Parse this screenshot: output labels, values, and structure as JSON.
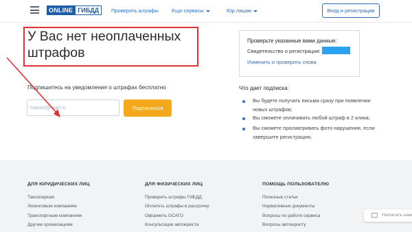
{
  "header": {
    "logo_part1": "ONLINE",
    "logo_part2": "ГИБДД",
    "nav": {
      "check_fines": "Проверить штрафы",
      "all_services": "Еще сервисы",
      "legal_entities": "Юр.лицам"
    },
    "login_label": "Вход и регистрация"
  },
  "main": {
    "title": "У Вас нет неоплаченных штрафов",
    "subscribe_label": "Подпишитесь на уведомления о штрафах бесплатно",
    "email_placeholder": "ivanov@mail.ru",
    "subscribe_button": "Подписаться"
  },
  "card": {
    "title": "Проверьте указанные вами данные:",
    "cert_label": "Свидетельство о регистрации:",
    "change_link": "Изменить и проверить снова"
  },
  "benefits": {
    "title": "Что дает подписка:",
    "items": [
      "Вы будете получать письма сразу при появлении новых штрафов;",
      "Вы сможете оплачивать любой штраф в 2 клика;",
      "Вы сможете просматривать фото нарушения, если завершите регистрацию."
    ]
  },
  "footer": {
    "col1": {
      "heading": "ДЛЯ ЮРИДИЧЕСКИХ ЛИЦ",
      "links": [
        "Таксопаркам",
        "Лизинговым компаниям",
        "Транспортным компаниям",
        "Другим организациям"
      ]
    },
    "col2": {
      "heading": "ДЛЯ ФИЗИЧЕСКИХ ЛИЦ",
      "links": [
        "Проверить штрафы ГИБДД",
        "Оплатить штрафы в рассрочку",
        "Оформить ОСАГО",
        "Консультация автоюриста"
      ]
    },
    "col3": {
      "heading": "ПОМОЩЬ ПОЛЬЗОВАТЕЛЮ",
      "links": [
        "Полезные статьи",
        "Нормативные документы",
        "Вопросы по работе сервиса",
        "Вопросы автоюристу"
      ]
    },
    "chat_label": "Написать нам"
  },
  "colors": {
    "brand_blue": "#1d5ca8",
    "link_blue": "#2d6fc0",
    "accent_orange": "#f4a81b",
    "annotation_red": "#e03030",
    "highlight_blue": "#29a3f0"
  }
}
